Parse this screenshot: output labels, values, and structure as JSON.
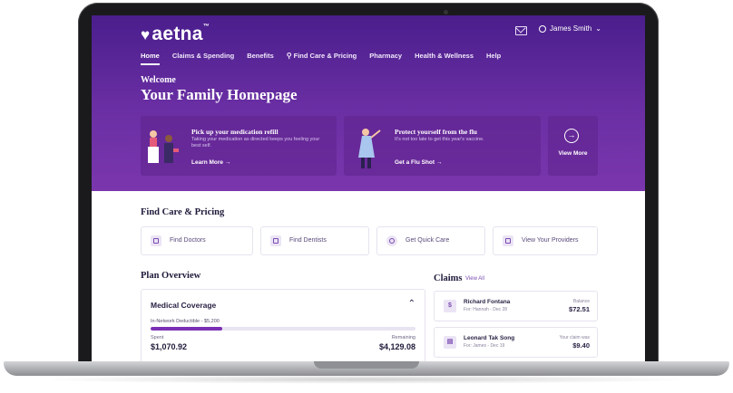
{
  "header": {
    "logo": "aetna",
    "logo_mark": "™",
    "user_name": "James Smith"
  },
  "nav": {
    "items": [
      {
        "label": "Home",
        "active": true
      },
      {
        "label": "Claims & Spending"
      },
      {
        "label": "Benefits"
      },
      {
        "label": "Find Care & Pricing"
      },
      {
        "label": "Pharmacy"
      },
      {
        "label": "Health & Wellness"
      },
      {
        "label": "Help"
      }
    ]
  },
  "hero": {
    "welcome": "Welcome",
    "title": "Your Family Homepage"
  },
  "promos": [
    {
      "title": "Pick up your medication refill",
      "text": "Taking your medication as directed keeps you feeling your best self.",
      "link": "Learn More →"
    },
    {
      "title": "Protect yourself from the flu",
      "text": "It's not too late to get this year's vaccine.",
      "link": "Get a Flu Shot →"
    }
  ],
  "view_more": {
    "label": "View More",
    "icon": "arrow-right-circle-icon"
  },
  "find_care": {
    "title": "Find Care & Pricing",
    "items": [
      {
        "label": "Find Doctors",
        "icon": "building-icon"
      },
      {
        "label": "Find Dentists",
        "icon": "tooth-icon"
      },
      {
        "label": "Get Quick Care",
        "icon": "clock-icon"
      },
      {
        "label": "View Your Providers",
        "icon": "card-icon"
      }
    ]
  },
  "plan": {
    "title": "Plan Overview",
    "coverage": "Medical Coverage",
    "deductible_label": "In-Network Deductible - $5,200",
    "progress_fraction": 0.27,
    "spent_label": "Spent",
    "spent_value": "$1,070.92",
    "remaining_label": "Remaining",
    "remaining_value": "$4,129.08"
  },
  "claims": {
    "title": "Claims",
    "view_all": "View All",
    "items": [
      {
        "name": "Richard Fontana",
        "sub": "For: Hannah - Dec 28",
        "amount_label": "Balance",
        "amount": "$72.51"
      },
      {
        "name": "Leonard Tak Song",
        "sub": "For: James - Dec 19",
        "amount_label": "Your claim was",
        "amount": "$9.40"
      }
    ]
  },
  "colors": {
    "brand_purple": "#6b2fa4",
    "accent": "#7b2fb5"
  }
}
